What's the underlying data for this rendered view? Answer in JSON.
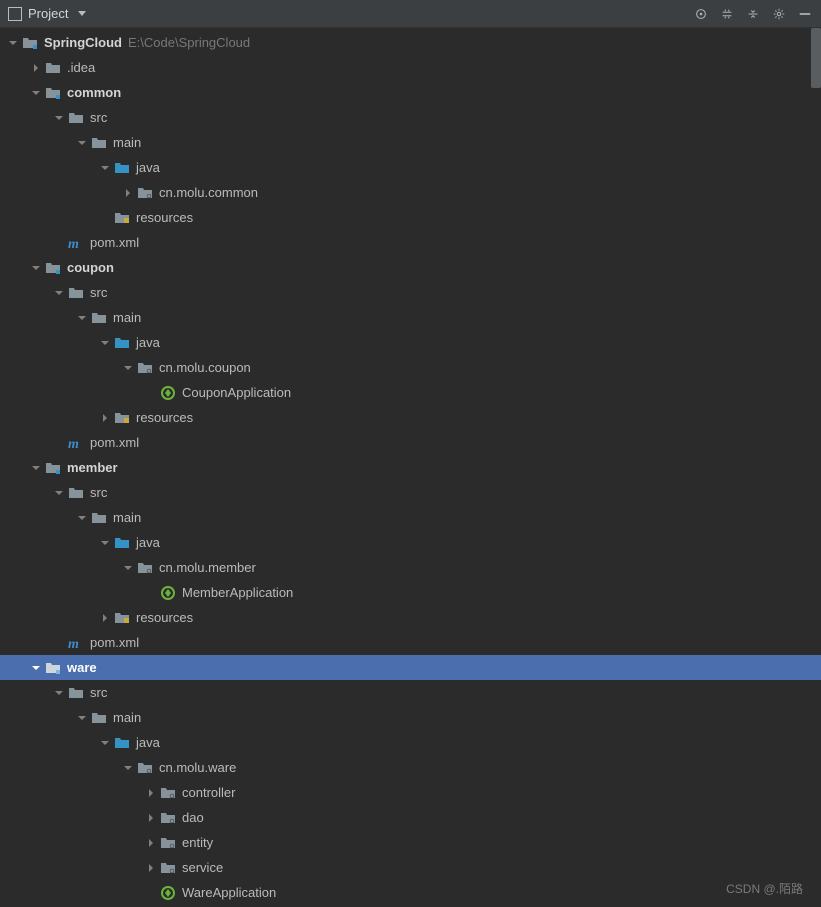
{
  "toolbar": {
    "viewLabel": "Project"
  },
  "root": {
    "name": "SpringCloud",
    "path": "E:\\Code\\SpringCloud"
  },
  "nodes": {
    "idea": ".idea",
    "common": "common",
    "src": "src",
    "main": "main",
    "java": "java",
    "cnMoluCommon": "cn.molu.common",
    "resources": "resources",
    "pomXml": "pom.xml",
    "coupon": "coupon",
    "cnMoluCoupon": "cn.molu.coupon",
    "couponApp": "CouponApplication",
    "member": "member",
    "cnMoluMember": "cn.molu.member",
    "memberApp": "MemberApplication",
    "ware": "ware",
    "cnMoluWare": "cn.molu.ware",
    "controller": "controller",
    "dao": "dao",
    "entity": "entity",
    "service": "service",
    "wareApp": "WareApplication"
  },
  "watermark": "CSDN @.陌路"
}
